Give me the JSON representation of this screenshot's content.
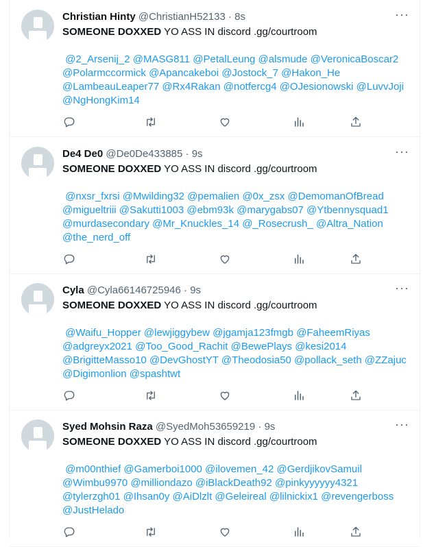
{
  "tweets": [
    {
      "name": "Christian Hinty",
      "handle": "@ChristianH52133",
      "separator": "·",
      "time": "8s",
      "text_bold": "SOMEONE DOXXED",
      "text_rest": " YO ASS IN discord .gg/courtroom",
      "mentions_lines": [
        " @2_Arsenij_2 @MASG811 @PetalLeung @alsmude @VeronicaBoscar2",
        "@Polarmccormick @Apancakeboi @Jostock_7 @Hakon_He",
        "@LambeauLeaper77 @Rx4Rakan @notfercg4 @OJesionowski @LuvvJoji",
        "@NgHongKim14"
      ]
    },
    {
      "name": "De4 De0",
      "handle": "@De0De433885",
      "separator": "·",
      "time": "9s",
      "text_bold": "SOMEONE DOXXED",
      "text_rest": " YO ASS IN discord .gg/courtroom",
      "mentions_lines": [
        " @nxsr_fxrsi @Mwilding32 @pemalien @0x_zsx @DemomanOfBread",
        "@migueltriii @Sakutti1003 @ebm93k @marygabs07 @Ytbennysquad1",
        "@murdasecondary @Mr_Knuckles_14 @_Rosecrush_ @Altra_Nation",
        "@the_nerd_off"
      ]
    },
    {
      "name": "Cyla",
      "handle": "@Cyla66146725946",
      "separator": "·",
      "time": "9s",
      "text_bold": "SOMEONE DOXXED",
      "text_rest": " YO ASS IN discord .gg/courtroom",
      "mentions_lines": [
        " @Waifu_Hopper @lewjiggybew @jgamja123fmgb @FaheemRiyas",
        "@adgreyx2021 @Too_Good_Rachit @BewePlays @kesi2014",
        "@BrigitteMasso10 @DevGhostYT @Theodosia50 @pollack_seth @ZZajuc",
        "@Digimonlion @spashtwt"
      ]
    },
    {
      "name": "Syed Mohsin Raza",
      "handle": "@SyedMoh53659219",
      "separator": "·",
      "time": "9s",
      "text_bold": "SOMEONE DOXXED",
      "text_rest": " YO ASS IN discord .gg/courtroom",
      "mentions_lines": [
        " @m00nthief @Gamerboi1000 @ilovemen_42 @GerdjikovSamuil",
        "@Wimbu9970 @milliondazo @iBlackDeath92 @pinkyyyyyy4321",
        "@tylerzgh01 @Ihsan0y @AiDlzlt @Geleireal @lilnickix1 @revengerboss",
        "@JustHelado"
      ]
    }
  ],
  "icons": {
    "more": "more-horizontal-icon",
    "reply": "reply-icon",
    "retweet": "retweet-icon",
    "like": "like-icon",
    "views": "views-icon",
    "share": "share-icon"
  },
  "colors": {
    "name": "#0f1419",
    "secondary": "#536471",
    "link": "#1d9bf0",
    "avatar": "#cfd9de",
    "divider": "#eff3f4"
  }
}
